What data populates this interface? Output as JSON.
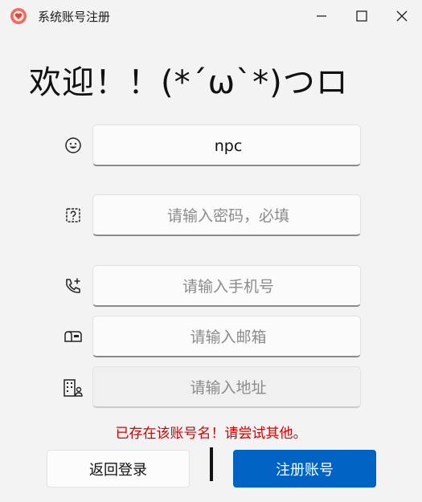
{
  "window": {
    "title": "系统账号注册",
    "accent": "#0062c2",
    "icons": {
      "app": "heart-logo-icon",
      "minimize": "minimize-icon",
      "maximize": "maximize-icon",
      "close": "close-icon"
    }
  },
  "welcome": "欢迎！！(*´ω`*)つロ",
  "form": {
    "username": {
      "value": "npc",
      "placeholder": "",
      "icon": "smiley-icon"
    },
    "password": {
      "value": "",
      "placeholder": "请输入密码，必填",
      "icon": "password-question-icon"
    },
    "phone": {
      "value": "",
      "placeholder": "请输入手机号",
      "icon": "phone-add-icon"
    },
    "email": {
      "value": "",
      "placeholder": "请输入邮箱",
      "icon": "mailbox-icon"
    },
    "address": {
      "value": "",
      "placeholder": "请输入地址",
      "icon": "building-person-icon"
    }
  },
  "error": "已存在该账号名！请尝试其他。",
  "buttons": {
    "back": "返回登录",
    "register": "注册账号"
  }
}
